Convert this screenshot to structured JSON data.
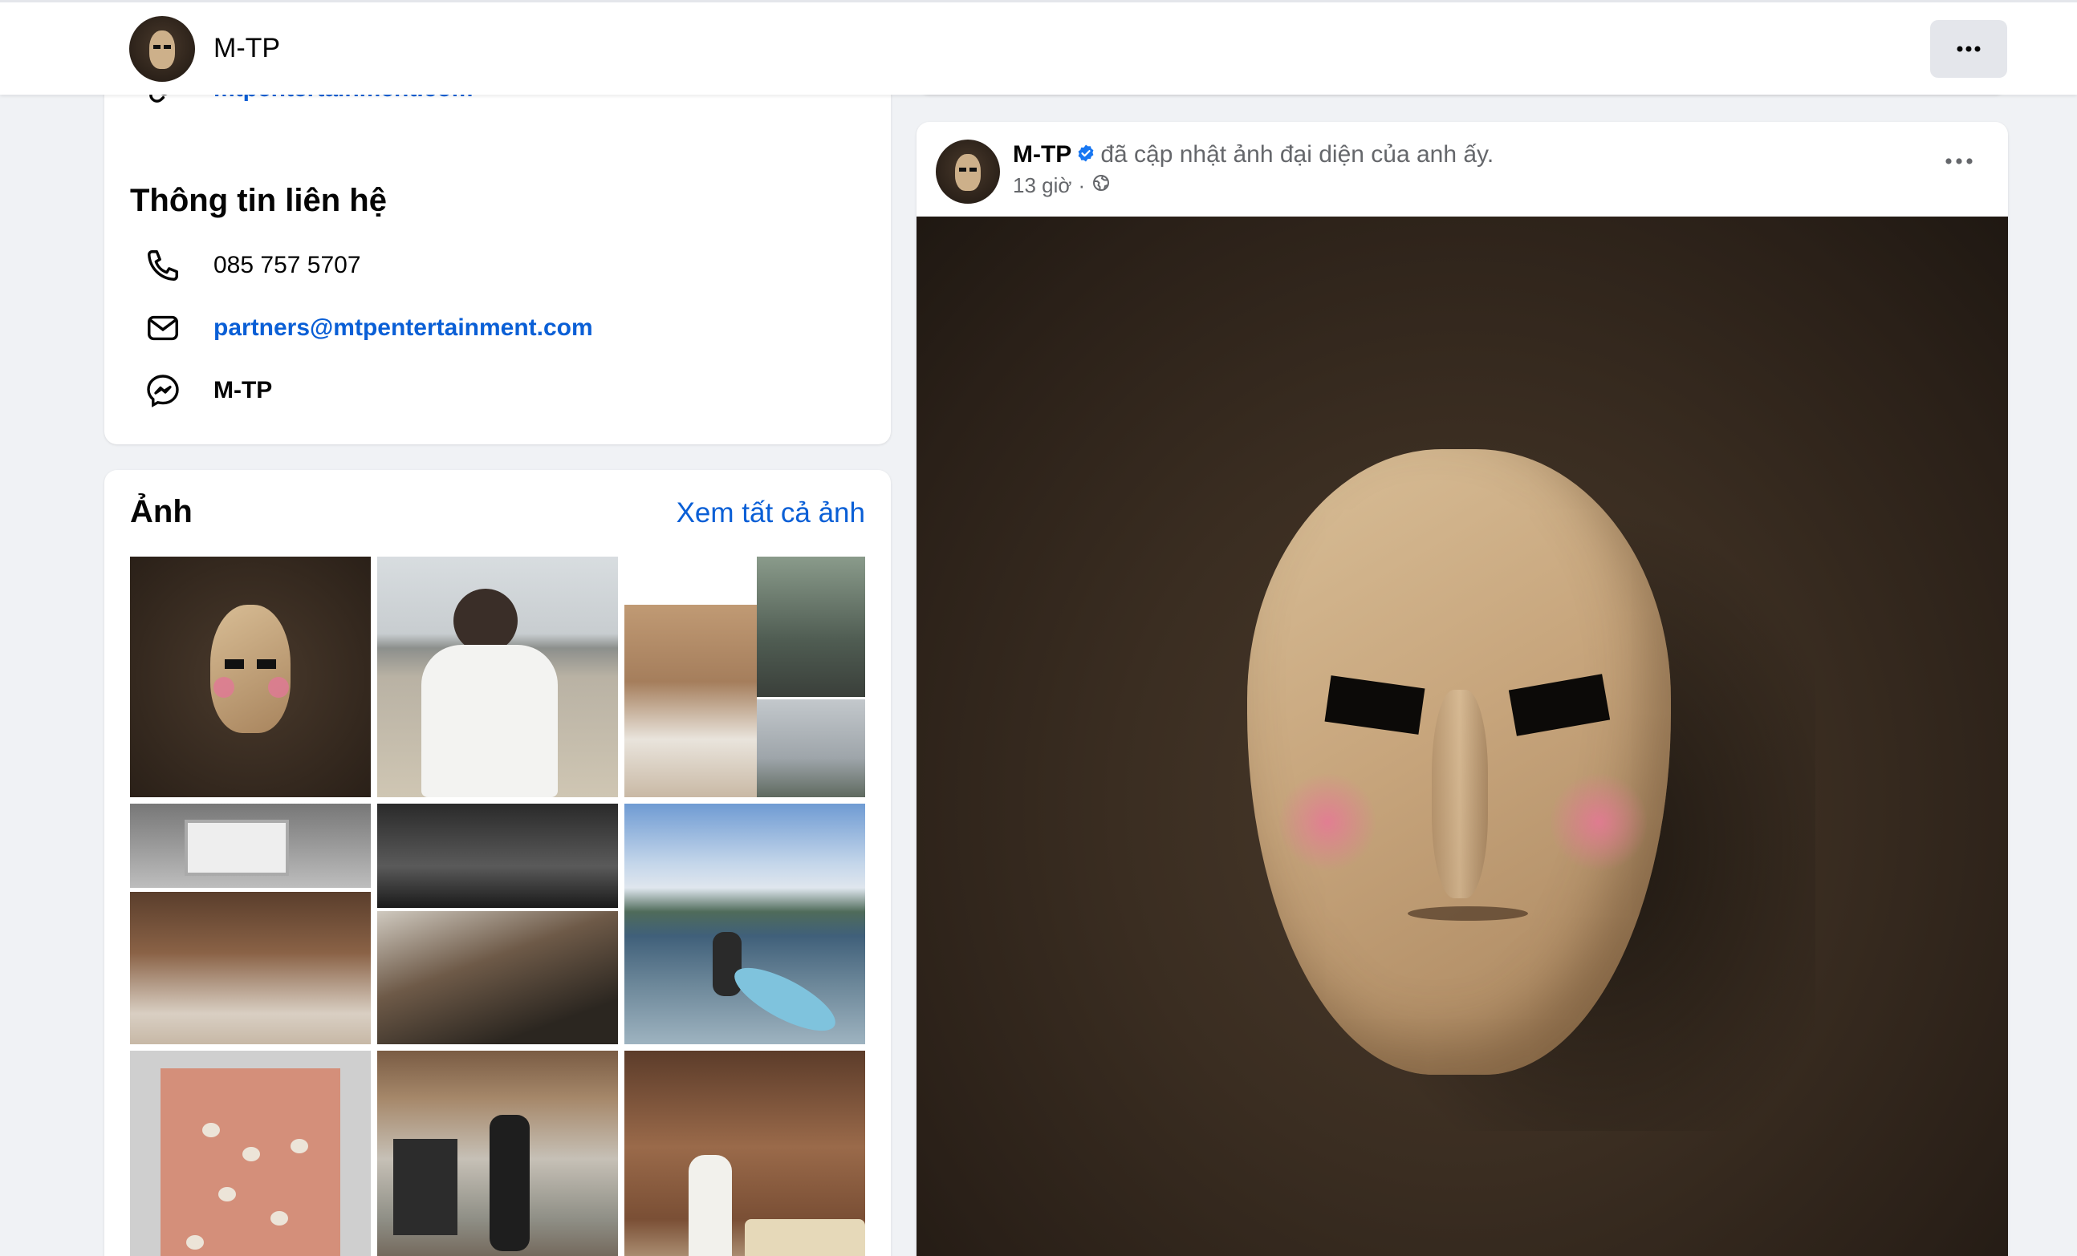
{
  "header": {
    "name": "M-TP",
    "more_icon": "ellipsis-icon"
  },
  "intro": {
    "website": "mtpentertainment.com",
    "contact_title": "Thông tin liên hệ",
    "phone": "085 757 5707",
    "email": "partners@mtpentertainment.com",
    "messenger": "M-TP"
  },
  "photos": {
    "title": "Ảnh",
    "see_all": "Xem tất cả ảnh",
    "tiles": [
      "mask-portrait",
      "man-white-shirt-beach",
      "collage-resort-dining",
      "collage-bedroom-bathroom",
      "collage-studio-piano",
      "kayak-sea",
      "seashells-on-towel",
      "gym-room",
      "man-white-suit-lounge"
    ]
  },
  "post": {
    "author": "M-TP",
    "action": "đã cập nhật ảnh đại diện của anh ấy.",
    "time": "13 giờ",
    "separator": "·",
    "privacy_icon": "globe-icon",
    "verified_icon": "verified-badge-icon",
    "image_subject": "wooden mask with pink cheeks",
    "colors": {
      "link": "#0a5fd6",
      "verified": "#1877f2",
      "background": "#f0f2f5"
    }
  }
}
